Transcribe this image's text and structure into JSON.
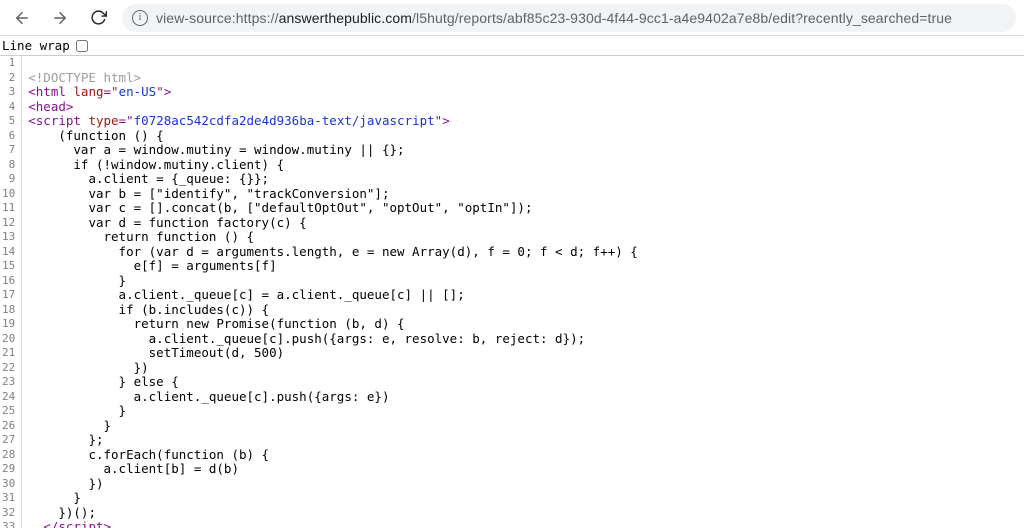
{
  "toolbar": {
    "url_prefix": "view-source:https://",
    "url_host_bold": "answerthepublic.com",
    "url_path": "/l5hutg/reports/abf85c23-930d-4f44-9cc1-a4e9402a7e8b/edit?recently_searched=true"
  },
  "linewrap": {
    "label": "Line wrap"
  },
  "source_lines": [
    {
      "n": 1,
      "segs": []
    },
    {
      "n": 2,
      "segs": [
        {
          "t": "<!DOCTYPE html>",
          "c": "c-doctype"
        }
      ]
    },
    {
      "n": 3,
      "segs": [
        {
          "t": "<html ",
          "c": "c-tag"
        },
        {
          "t": "lang",
          "c": "c-attr"
        },
        {
          "t": "=\"",
          "c": "c-tag"
        },
        {
          "t": "en-US",
          "c": "c-val"
        },
        {
          "t": "\">",
          "c": "c-tag"
        }
      ]
    },
    {
      "n": 4,
      "segs": [
        {
          "t": "<head>",
          "c": "c-tag"
        }
      ]
    },
    {
      "n": 5,
      "segs": [
        {
          "t": "<script ",
          "c": "c-tag"
        },
        {
          "t": "type",
          "c": "c-attr"
        },
        {
          "t": "=\"",
          "c": "c-tag"
        },
        {
          "t": "f0728ac542cdfa2de4d936ba-text/javascript",
          "c": "c-val"
        },
        {
          "t": "\">",
          "c": "c-tag"
        }
      ]
    },
    {
      "n": 6,
      "segs": [
        {
          "t": "    (function () {",
          "c": "c-plain"
        }
      ]
    },
    {
      "n": 7,
      "segs": [
        {
          "t": "      var a = window.mutiny = window.mutiny || {};",
          "c": "c-plain"
        }
      ]
    },
    {
      "n": 8,
      "segs": [
        {
          "t": "      if (!window.mutiny.client) {",
          "c": "c-plain"
        }
      ]
    },
    {
      "n": 9,
      "segs": [
        {
          "t": "        a.client = {_queue: {}};",
          "c": "c-plain"
        }
      ]
    },
    {
      "n": 10,
      "segs": [
        {
          "t": "        var b = [\"identify\", \"trackConversion\"];",
          "c": "c-plain"
        }
      ]
    },
    {
      "n": 11,
      "segs": [
        {
          "t": "        var c = [].concat(b, [\"defaultOptOut\", \"optOut\", \"optIn\"]);",
          "c": "c-plain"
        }
      ]
    },
    {
      "n": 12,
      "segs": [
        {
          "t": "        var d = function factory(c) {",
          "c": "c-plain"
        }
      ]
    },
    {
      "n": 13,
      "segs": [
        {
          "t": "          return function () {",
          "c": "c-plain"
        }
      ]
    },
    {
      "n": 14,
      "segs": [
        {
          "t": "            for (var d = arguments.length, e = new Array(d), f = 0; f < d; f++) {",
          "c": "c-plain"
        }
      ]
    },
    {
      "n": 15,
      "segs": [
        {
          "t": "              e[f] = arguments[f]",
          "c": "c-plain"
        }
      ]
    },
    {
      "n": 16,
      "segs": [
        {
          "t": "            }",
          "c": "c-plain"
        }
      ]
    },
    {
      "n": 17,
      "segs": [
        {
          "t": "            a.client._queue[c] = a.client._queue[c] || [];",
          "c": "c-plain"
        }
      ]
    },
    {
      "n": 18,
      "segs": [
        {
          "t": "            if (b.includes(c)) {",
          "c": "c-plain"
        }
      ]
    },
    {
      "n": 19,
      "segs": [
        {
          "t": "              return new Promise(function (b, d) {",
          "c": "c-plain"
        }
      ]
    },
    {
      "n": 20,
      "segs": [
        {
          "t": "                a.client._queue[c].push({args: e, resolve: b, reject: d});",
          "c": "c-plain"
        }
      ]
    },
    {
      "n": 21,
      "segs": [
        {
          "t": "                setTimeout(d, 500)",
          "c": "c-plain"
        }
      ]
    },
    {
      "n": 22,
      "segs": [
        {
          "t": "              })",
          "c": "c-plain"
        }
      ]
    },
    {
      "n": 23,
      "segs": [
        {
          "t": "            } else {",
          "c": "c-plain"
        }
      ]
    },
    {
      "n": 24,
      "segs": [
        {
          "t": "              a.client._queue[c].push({args: e})",
          "c": "c-plain"
        }
      ]
    },
    {
      "n": 25,
      "segs": [
        {
          "t": "            }",
          "c": "c-plain"
        }
      ]
    },
    {
      "n": 26,
      "segs": [
        {
          "t": "          }",
          "c": "c-plain"
        }
      ]
    },
    {
      "n": 27,
      "segs": [
        {
          "t": "        };",
          "c": "c-plain"
        }
      ]
    },
    {
      "n": 28,
      "segs": [
        {
          "t": "        c.forEach(function (b) {",
          "c": "c-plain"
        }
      ]
    },
    {
      "n": 29,
      "segs": [
        {
          "t": "          a.client[b] = d(b)",
          "c": "c-plain"
        }
      ]
    },
    {
      "n": 30,
      "segs": [
        {
          "t": "        })",
          "c": "c-plain"
        }
      ]
    },
    {
      "n": 31,
      "segs": [
        {
          "t": "      }",
          "c": "c-plain"
        }
      ]
    },
    {
      "n": 32,
      "segs": [
        {
          "t": "    })();",
          "c": "c-plain"
        }
      ]
    },
    {
      "n": 33,
      "segs": [
        {
          "t": "  ",
          "c": "c-plain"
        },
        {
          "t": "</script>",
          "c": "c-tag"
        }
      ]
    }
  ]
}
